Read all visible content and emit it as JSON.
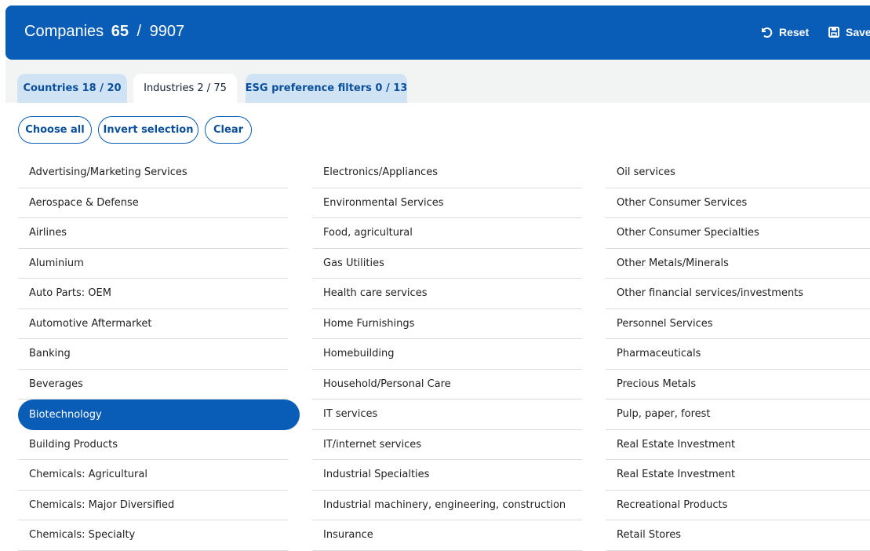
{
  "header": {
    "title": "Companies",
    "selected_count": "65",
    "separator": "/",
    "total_count": "9907",
    "reset_label": "Reset",
    "save_label": "Save",
    "background": "#0a5db7"
  },
  "tabs": [
    {
      "label": "Countries 18 / 20",
      "active": false
    },
    {
      "label": "Industries 2 / 75",
      "active": true
    },
    {
      "label": "ESG preference filters 0 / 13",
      "active": false
    }
  ],
  "actions": {
    "choose_all": "Choose all",
    "invert_selection": "Invert selection",
    "clear": "Clear"
  },
  "industries": {
    "column1": [
      "Advertising/Marketing Services",
      "Aerospace & Defense",
      "Airlines",
      "Aluminium",
      "Auto Parts: OEM",
      "Automotive Aftermarket",
      "Banking",
      "Beverages",
      "Biotechnology",
      "Building Products",
      "Chemicals: Agricultural",
      "Chemicals: Major Diversified",
      "Chemicals: Specialty"
    ],
    "column2": [
      "Electronics/Appliances",
      "Environmental Services",
      "Food, agricultural",
      "Gas Utilities",
      "Health care services",
      "Home Furnishings",
      "Homebuilding",
      "Household/Personal Care",
      "IT services",
      "IT/internet services",
      "Industrial Specialties",
      "Industrial machinery, engineering, construction",
      "Insurance"
    ],
    "column3": [
      "Oil services",
      "Other Consumer Services",
      "Other Consumer Specialties",
      "Other Metals/Minerals",
      "Other financial services/investments",
      "Personnel Services",
      "Pharmaceuticals",
      "Precious Metals",
      "Pulp, paper, forest",
      "Real Estate Investment",
      "Real Estate Investment",
      "Recreational Products",
      "Retail Stores"
    ],
    "selected": [
      "Biotechnology"
    ]
  }
}
